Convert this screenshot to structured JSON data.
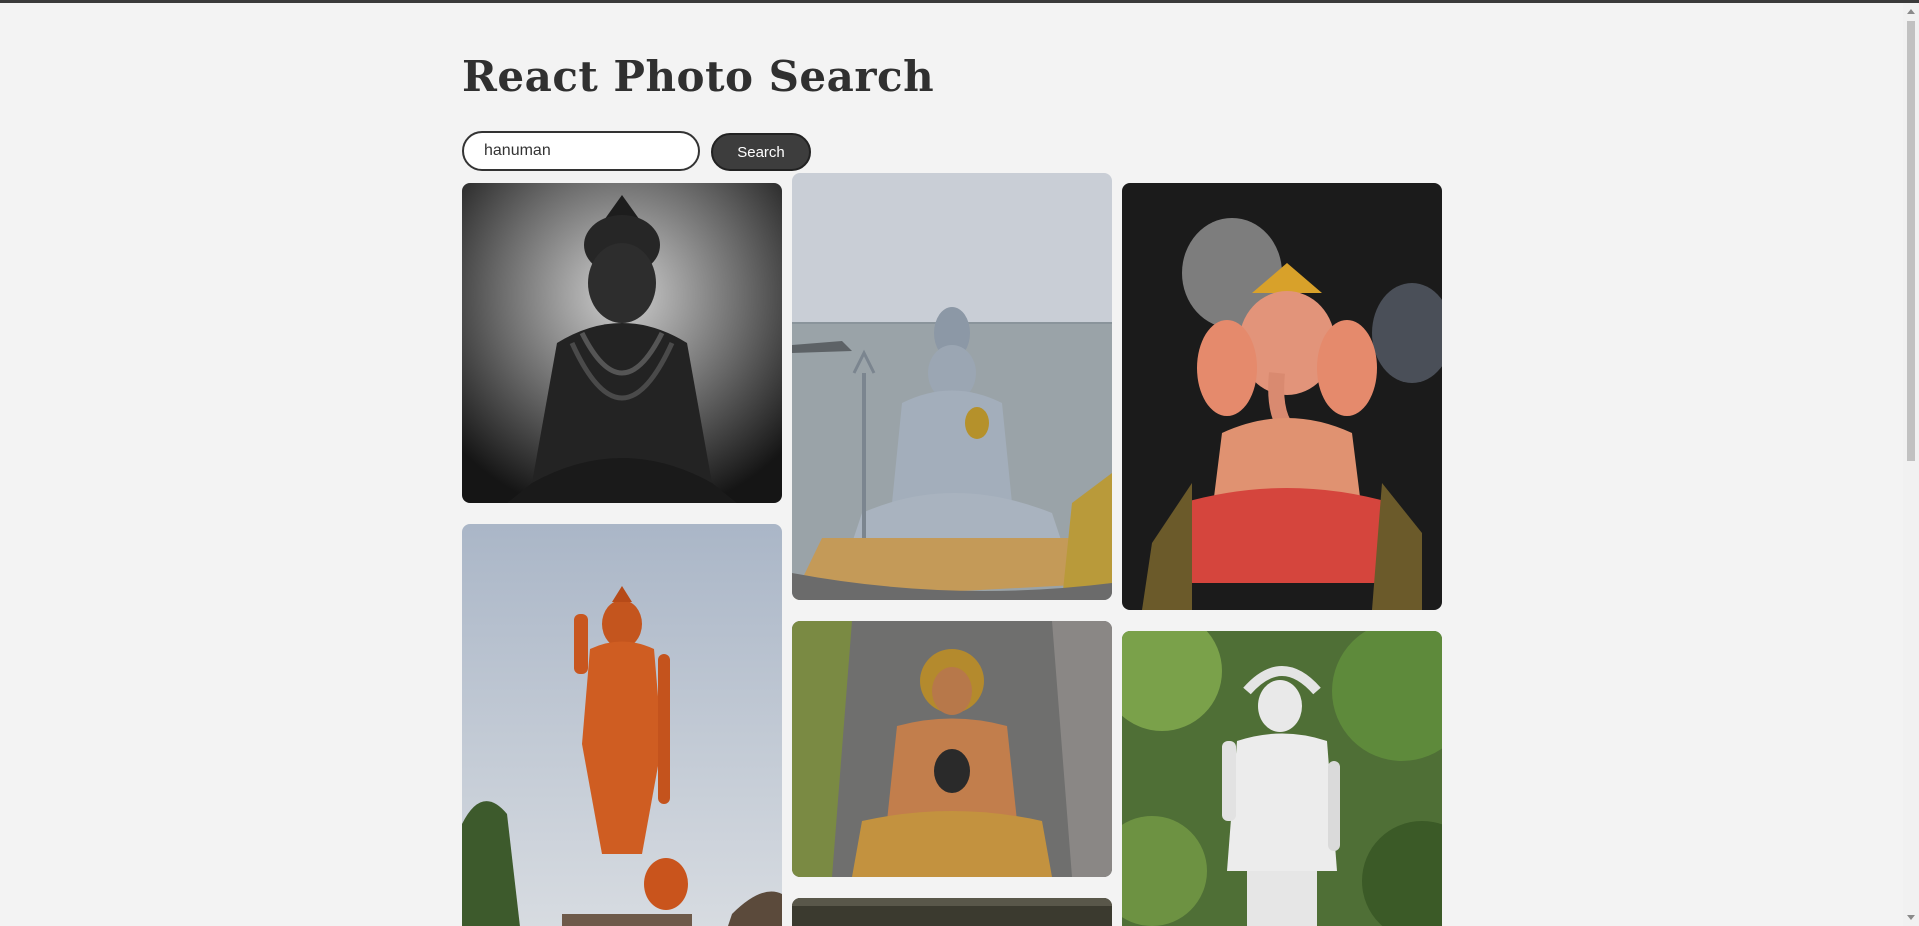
{
  "app": {
    "title": "React Photo Search"
  },
  "search": {
    "value": "hanuman",
    "button_label": "Search"
  },
  "photos": [
    {
      "name": "photo-hanuman-statue-black-white"
    },
    {
      "name": "photo-shiva-statue-ocean"
    },
    {
      "name": "photo-ganesha-idol"
    },
    {
      "name": "photo-hanuman-statue-orange"
    },
    {
      "name": "photo-hanuman-cave-statue"
    },
    {
      "name": "photo-hanuman-statue-white-forest"
    },
    {
      "name": "photo-partial-bottom"
    }
  ]
}
